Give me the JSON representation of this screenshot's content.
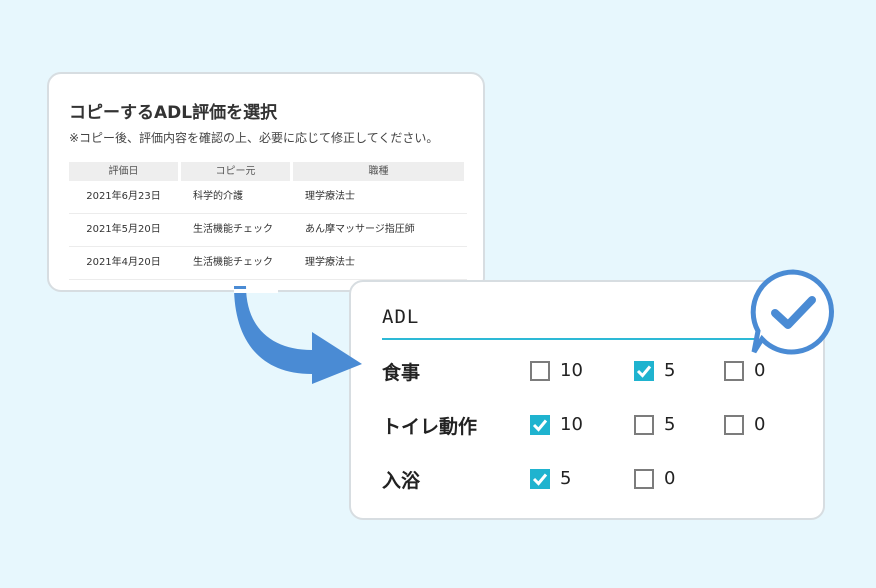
{
  "dialog": {
    "title": "コピーするADL評価を選択",
    "note": "※コピー後、評価内容を確認の上、必要に応じて修正してください。",
    "columns": [
      "評価日",
      "コピー元",
      "職種"
    ],
    "rows": [
      [
        "2021年6月23日",
        "科学的介護",
        "理学療法士"
      ],
      [
        "2021年5月20日",
        "生活機能チェック",
        "あん摩マッサージ指圧師"
      ],
      [
        "2021年4月20日",
        "生活機能チェック",
        "理学療法士"
      ]
    ]
  },
  "card": {
    "title": "ADL",
    "rows": [
      {
        "label": "食事",
        "options": [
          {
            "value": "10",
            "checked": false
          },
          {
            "value": "5",
            "checked": true
          },
          {
            "value": "0",
            "checked": false
          }
        ]
      },
      {
        "label": "トイレ動作",
        "options": [
          {
            "value": "10",
            "checked": true
          },
          {
            "value": "5",
            "checked": false
          },
          {
            "value": "0",
            "checked": false
          }
        ]
      },
      {
        "label": "入浴",
        "options": [
          {
            "value": "5",
            "checked": true
          },
          {
            "value": "0",
            "checked": false
          }
        ]
      }
    ]
  },
  "colors": {
    "background": "#e7f7fd",
    "accent": "#1fb3cf",
    "arrow": "#4a8bd4"
  },
  "icons": {
    "arrow": "curved-arrow-icon",
    "badge": "speech-check-icon"
  }
}
